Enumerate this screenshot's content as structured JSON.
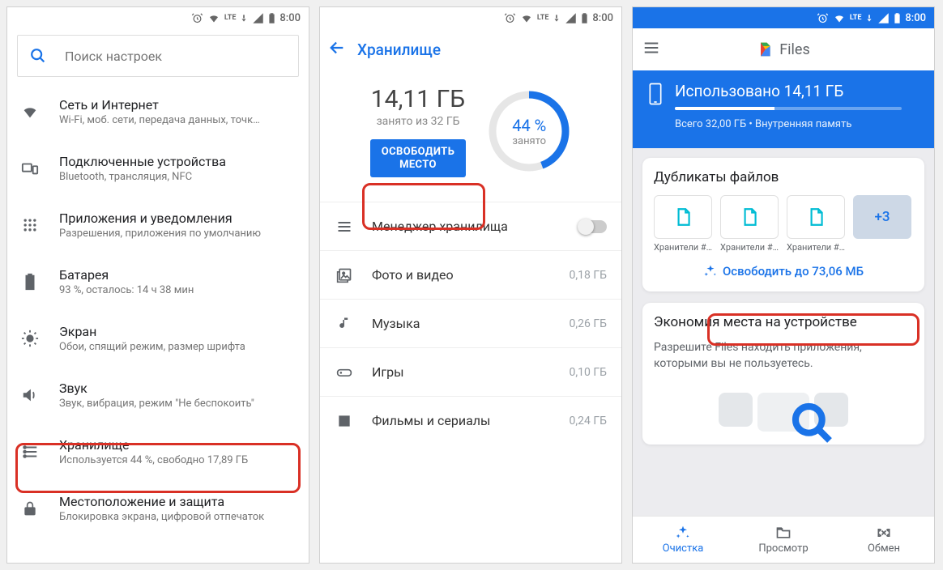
{
  "statusbar": {
    "time": "8:00",
    "lte": "LTE"
  },
  "settings": {
    "search_placeholder": "Поиск настроек",
    "items": [
      {
        "title": "Сеть и Интернет",
        "sub": "Wi-Fi, моб. сети, передача данных, точк…"
      },
      {
        "title": "Подключенные устройства",
        "sub": "Bluetooth, трансляция, NFC"
      },
      {
        "title": "Приложения и уведомления",
        "sub": "Разрешения, приложения по умолчанию"
      },
      {
        "title": "Батарея",
        "sub": "93 %, осталось: 14 ч 38 мин"
      },
      {
        "title": "Экран",
        "sub": "Обои, спящий режим, размер шрифта"
      },
      {
        "title": "Звук",
        "sub": "Звук, вибрация, режим \"Не беспокоить\""
      },
      {
        "title": "Хранилище",
        "sub": "Используется 44 %, свободно 17,89 ГБ"
      },
      {
        "title": "Местоположение и защита",
        "sub": "Блокировка экрана, цифровой отпечаток"
      }
    ]
  },
  "storage": {
    "appbar_title": "Хранилище",
    "used_value": "14,11 ГБ",
    "used_sub": "занято из 32 ГБ",
    "free_button_line1": "ОСВОБОДИТЬ",
    "free_button_line2": "МЕСТО",
    "ring_percent": "44 %",
    "ring_label": "занято",
    "percent_fraction": 0.44,
    "rows": [
      {
        "label": "Менеджер хранилища",
        "val": "",
        "toggle": true
      },
      {
        "label": "Фото и видео",
        "val": "0,18 ГБ"
      },
      {
        "label": "Музыка",
        "val": "0,26 ГБ"
      },
      {
        "label": "Игры",
        "val": "0,10 ГБ"
      },
      {
        "label": "Фильмы и сериалы",
        "val": "0,24 ГБ"
      }
    ]
  },
  "files": {
    "brand": "Files",
    "used_title": "Использовано 14,11 ГБ",
    "used_sub": "Всего 32,00 ГБ • Внутренняя память",
    "dup_card_title": "Дубликаты файлов",
    "dup_items": [
      {
        "name": "Хранители #…"
      },
      {
        "name": "Хранители #…"
      },
      {
        "name": "Хранители #…"
      }
    ],
    "dup_more": "+3",
    "dup_free_label": "Освободить до 73,06 МБ",
    "save_card_title": "Экономия места на устройстве",
    "save_card_sub": "Разрешите Files находить приложения, которыми вы не пользуетесь.",
    "nav": {
      "clean": "Очистка",
      "browse": "Просмотр",
      "share": "Обмен"
    }
  }
}
